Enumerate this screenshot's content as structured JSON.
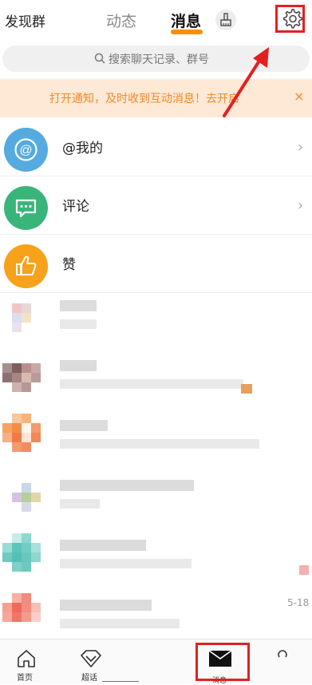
{
  "header": {
    "discover_label": "发现群",
    "tab_dongtai": "动态",
    "tab_xiaoxi": "消息",
    "accent_color": "#ff8c00"
  },
  "search": {
    "placeholder": "搜索聊天记录、群号"
  },
  "banner": {
    "text": "打开通知，及时收到互动消息！去开启",
    "close": "×"
  },
  "rows": [
    {
      "label": "@我的",
      "icon": "at-icon",
      "color": "#55aadf"
    },
    {
      "label": "评论",
      "icon": "comment-icon",
      "color": "#3ab57a"
    },
    {
      "label": "赞",
      "icon": "thumbs-up-icon",
      "color": "#f7a21b"
    }
  ],
  "chat_list": [
    {
      "date": ""
    },
    {
      "date": ""
    },
    {
      "date": ""
    },
    {
      "date": ""
    },
    {
      "date": ""
    },
    {
      "date": "5-18"
    }
  ],
  "tabbar": {
    "home_label": "首页",
    "chaohua_label": "超话",
    "message_label": "消息"
  },
  "highlight_color": "#e32020"
}
